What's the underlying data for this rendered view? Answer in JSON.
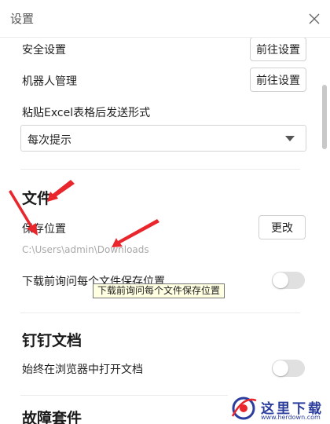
{
  "window": {
    "title": "设置"
  },
  "rows": {
    "security": {
      "label": "安全设置",
      "button": "前往设置"
    },
    "robot": {
      "label": "机器人管理",
      "button": "前往设置"
    }
  },
  "paste_excel": {
    "label": "粘贴Excel表格后发送形式",
    "selected": "每次提示"
  },
  "file": {
    "title": "文件",
    "save_label": "保存位置",
    "change_button": "更改",
    "path": "C:\\Users\\admin\\Downloads",
    "ask_label": "下载前询问每个文件保存位置",
    "ask_enabled": false,
    "tooltip": "下载前询问每个文件保存位置"
  },
  "dingtalk_docs": {
    "title": "钉钉文档",
    "browser_label": "始终在浏览器中打开文档",
    "browser_enabled": false
  },
  "cut_section": {
    "title": "故障套件"
  },
  "watermark": {
    "text": "这里下载",
    "url": "www.herdown.com"
  },
  "colors": {
    "annotation_red": "#e8262c",
    "toggle_off": "#e0e0e0",
    "watermark_blue": "#2b3e9e"
  }
}
